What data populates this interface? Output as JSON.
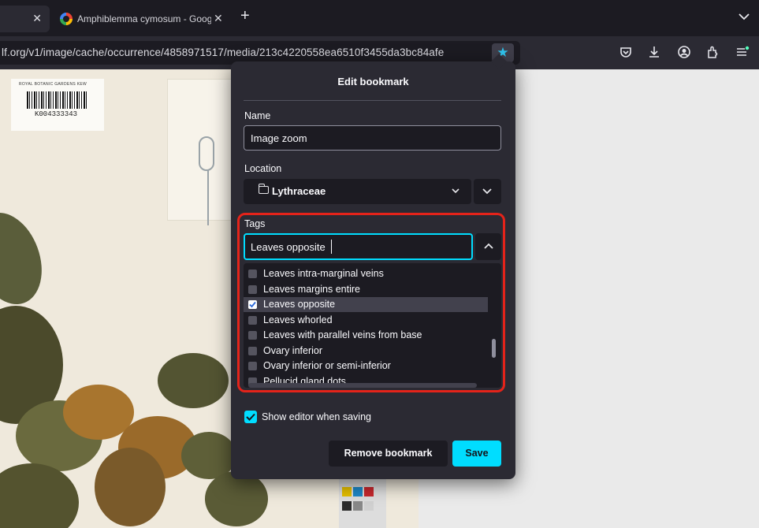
{
  "browser": {
    "tab_prev_close": "✕",
    "tab_active_title": "Amphiblemma cymosum - Goog",
    "tab_close": "✕",
    "new_tab": "+",
    "url": "lf.org/v1/image/cache/occurrence/4858971517/media/213c4220558ea6510f3455da3bc84afe",
    "bookmark_star": "★"
  },
  "specimen": {
    "institution": "ROYAL BOTANIC GARDENS KEW",
    "barcode_number": "K004333343"
  },
  "dialog": {
    "title": "Edit bookmark",
    "name_label": "Name",
    "name_value": "Image zoom",
    "location_label": "Location",
    "location_value": "Lythraceae",
    "tags_label": "Tags",
    "tags_value": "Leaves opposite",
    "tags": [
      {
        "label": "Leaves intra-marginal veins",
        "checked": false
      },
      {
        "label": "Leaves margins entire",
        "checked": false
      },
      {
        "label": "Leaves opposite",
        "checked": true
      },
      {
        "label": "Leaves whorled",
        "checked": false
      },
      {
        "label": "Leaves with parallel veins from base",
        "checked": false
      },
      {
        "label": "Ovary inferior",
        "checked": false
      },
      {
        "label": "Ovary inferior or semi-inferior",
        "checked": false
      },
      {
        "label": "Pellucid gland dots",
        "checked": false
      }
    ],
    "show_editor_label": "Show editor when saving",
    "show_editor_checked": true,
    "remove_button": "Remove bookmark",
    "save_button": "Save"
  },
  "colors": {
    "accent": "#00ddff",
    "highlight_box": "#e4231a",
    "star": "#2fc4ee"
  }
}
